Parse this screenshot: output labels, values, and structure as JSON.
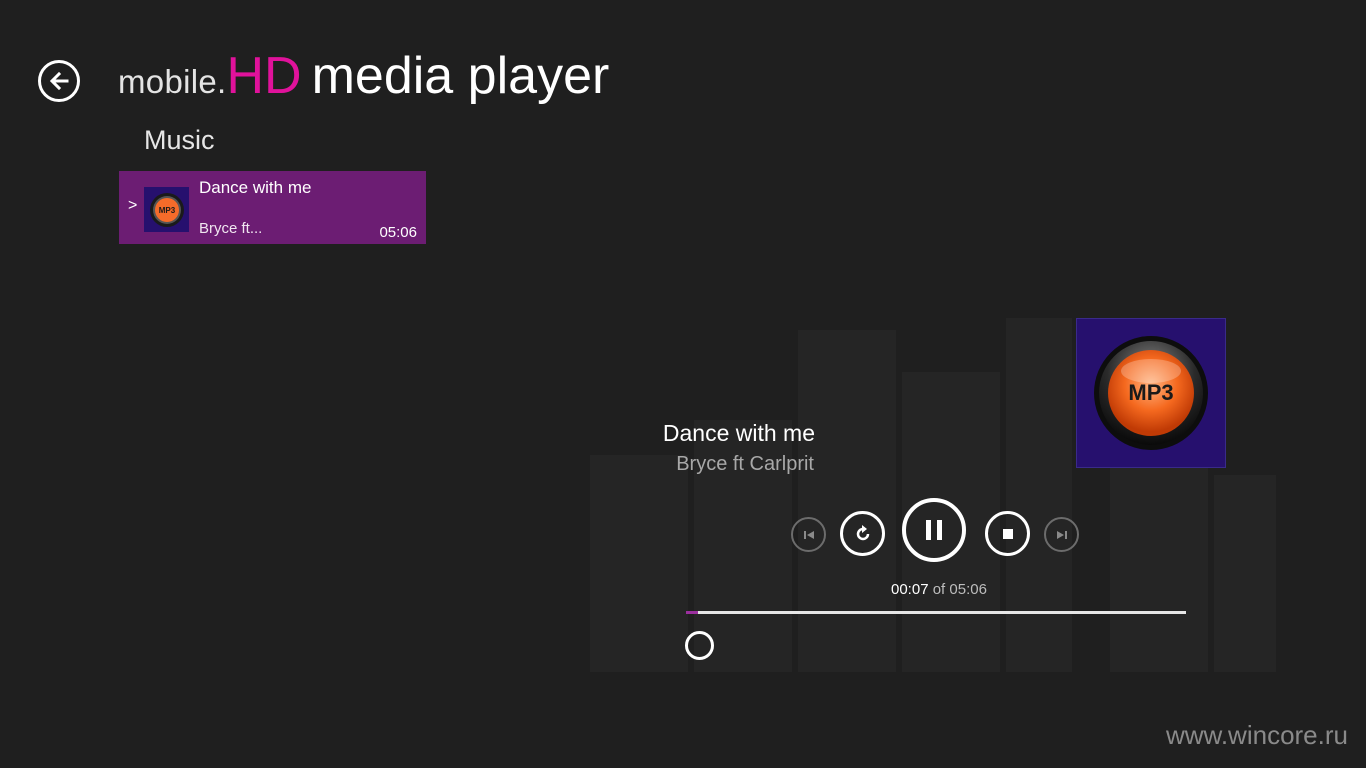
{
  "header": {
    "title_prefix": "mobile.",
    "title_brand": "HD",
    "title_rest": "media player",
    "section": "Music",
    "brand_color": "#e0129b"
  },
  "playlist": {
    "items": [
      {
        "indicator": ">",
        "title": "Dance with me",
        "artist": "Bryce ft...",
        "duration": "05:06",
        "thumb_icon": "mp3-icon",
        "thumb_text": "MP3"
      }
    ],
    "selected_color": "#6c1d73"
  },
  "now_playing": {
    "title": "Dance with me",
    "artist": "Bryce ft Carlprit",
    "album_art_icon": "mp3-icon",
    "album_art_text": "MP3",
    "current_time": "00:07",
    "time_separator": "of",
    "total_time": "05:06",
    "progress_fraction": 0.023
  },
  "controls": [
    {
      "name": "previous-button",
      "icon": "skip-previous-icon"
    },
    {
      "name": "repeat-button",
      "icon": "repeat-icon"
    },
    {
      "name": "pause-button",
      "icon": "pause-icon"
    },
    {
      "name": "stop-button",
      "icon": "stop-icon"
    },
    {
      "name": "next-button",
      "icon": "skip-next-icon"
    }
  ],
  "watermark": "www.wincore.ru"
}
